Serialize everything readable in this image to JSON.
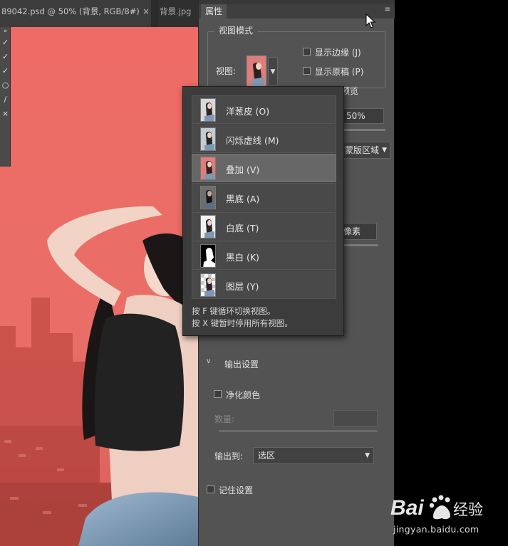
{
  "document_tabs": [
    {
      "label": "89042.psd @ 50% (背景, RGB/8#) *"
    },
    {
      "label": "背景.jpg"
    }
  ],
  "tab_close_glyph": "×",
  "toolbar": {
    "grip": "»",
    "tools": [
      "✓",
      "✓",
      "✓",
      "○",
      "/",
      "×"
    ]
  },
  "properties_panel": {
    "tab_label": "属性",
    "view_mode": {
      "title": "视图模式",
      "view_label": "视图:",
      "show_edge_label": "显示边缘 (J)",
      "show_original_label": "显示原稿 (P)",
      "preview_label": "预览",
      "opacity_value": "50%",
      "region_value": "蒙版区域"
    },
    "pixel_value": "像素",
    "output": {
      "header": "输出设置",
      "decontaminate_label": "净化颜色",
      "amount_label": "数量:",
      "output_to_label": "输出到:",
      "output_to_value": "选区"
    },
    "remember_label": "记住设置"
  },
  "view_popup": {
    "options": [
      {
        "label": "洋葱皮 (O)",
        "thumb": "onion"
      },
      {
        "label": "闪烁虚线 (M)",
        "thumb": "marching"
      },
      {
        "label": "叠加 (V)",
        "thumb": "overlay",
        "selected": true
      },
      {
        "label": "黑底 (A)",
        "thumb": "black"
      },
      {
        "label": "白底 (T)",
        "thumb": "white"
      },
      {
        "label": "黑白 (K)",
        "thumb": "bw"
      },
      {
        "label": "图层 (Y)",
        "thumb": "layer"
      }
    ],
    "hint_1": "按 F 键循环切换视图。",
    "hint_2": "按 X 键暂时停用所有视图。"
  },
  "watermark": {
    "logo_text": "Bai百度经验",
    "url": "jingyan.baidu.com"
  },
  "colors": {
    "panel_bg": "#535353",
    "popup_bg": "#3c3c3c",
    "overlay_red": "#e86e68",
    "selected_item": "#676767"
  }
}
